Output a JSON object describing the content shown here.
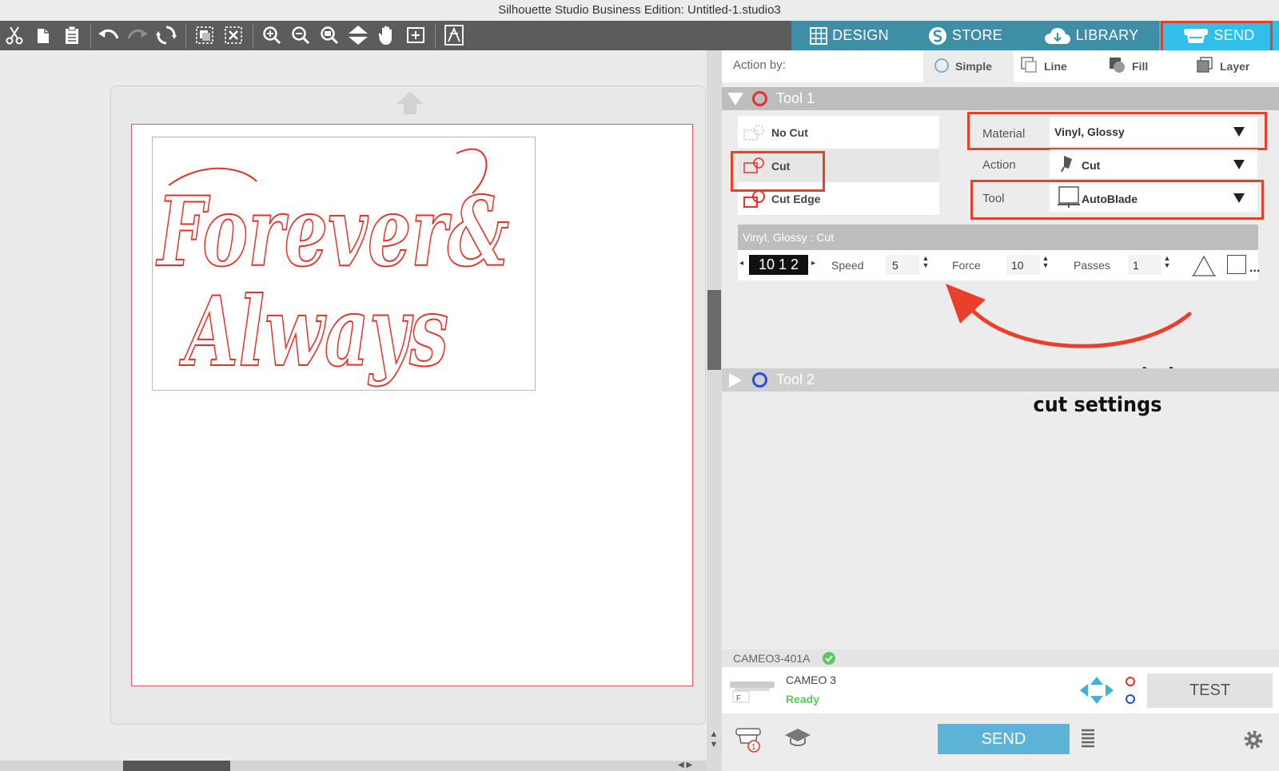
{
  "window": {
    "title": "Silhouette Studio Business Edition: Untitled-1.studio3"
  },
  "nav_tabs": [
    {
      "label": "DESIGN",
      "icon": "grid-icon"
    },
    {
      "label": "STORE",
      "icon": "store-s-icon"
    },
    {
      "label": "LIBRARY",
      "icon": "cloud-icon"
    },
    {
      "label": "SEND",
      "icon": "cutter-icon",
      "active": true
    }
  ],
  "toolbar_icons": [
    "scissors-icon",
    "copy-icon",
    "paste-icon",
    "undo-icon",
    "redo-icon",
    "replicate-icon",
    "group-icon",
    "ungroup-icon",
    "zoom-in-icon",
    "zoom-out-icon",
    "zoom-select-icon",
    "move-down-icon",
    "pan-hand-icon",
    "fit-page-icon",
    "trace-icon"
  ],
  "design": {
    "line1": "Forever&",
    "line2": "Always",
    "stroke_color": "#e8302b"
  },
  "panel": {
    "action_by_label": "Action by:",
    "modes": [
      "Simple",
      "Line",
      "Fill",
      "Layer"
    ],
    "tool1": {
      "title": "Tool 1",
      "color": "#e8302b"
    },
    "tool2": {
      "title": "Tool 2",
      "color": "#2250d8"
    },
    "cut_options": [
      "No Cut",
      "Cut",
      "Cut Edge"
    ],
    "material": {
      "label": "Material",
      "value": "Vinyl, Glossy"
    },
    "action": {
      "label": "Action",
      "value": "Cut"
    },
    "tool": {
      "label": "Tool",
      "value": "AutoBlade"
    },
    "summary": "Vinyl, Glossy : Cut",
    "blade_display": "10 1 2",
    "speed": {
      "label": "Speed",
      "value": "5"
    },
    "force": {
      "label": "Force",
      "value": "10"
    },
    "passes": {
      "label": "Passes",
      "value": "1"
    },
    "more": "..."
  },
  "annotation": {
    "line1": "recommended",
    "line2": "cut settings",
    "color": "#e8402b"
  },
  "device": {
    "id": "CAMEO3-401A",
    "name": "CAMEO 3",
    "status": "Ready",
    "status_color": "#5cc85c",
    "test_label": "TEST"
  },
  "footer": {
    "send_label": "SEND"
  }
}
